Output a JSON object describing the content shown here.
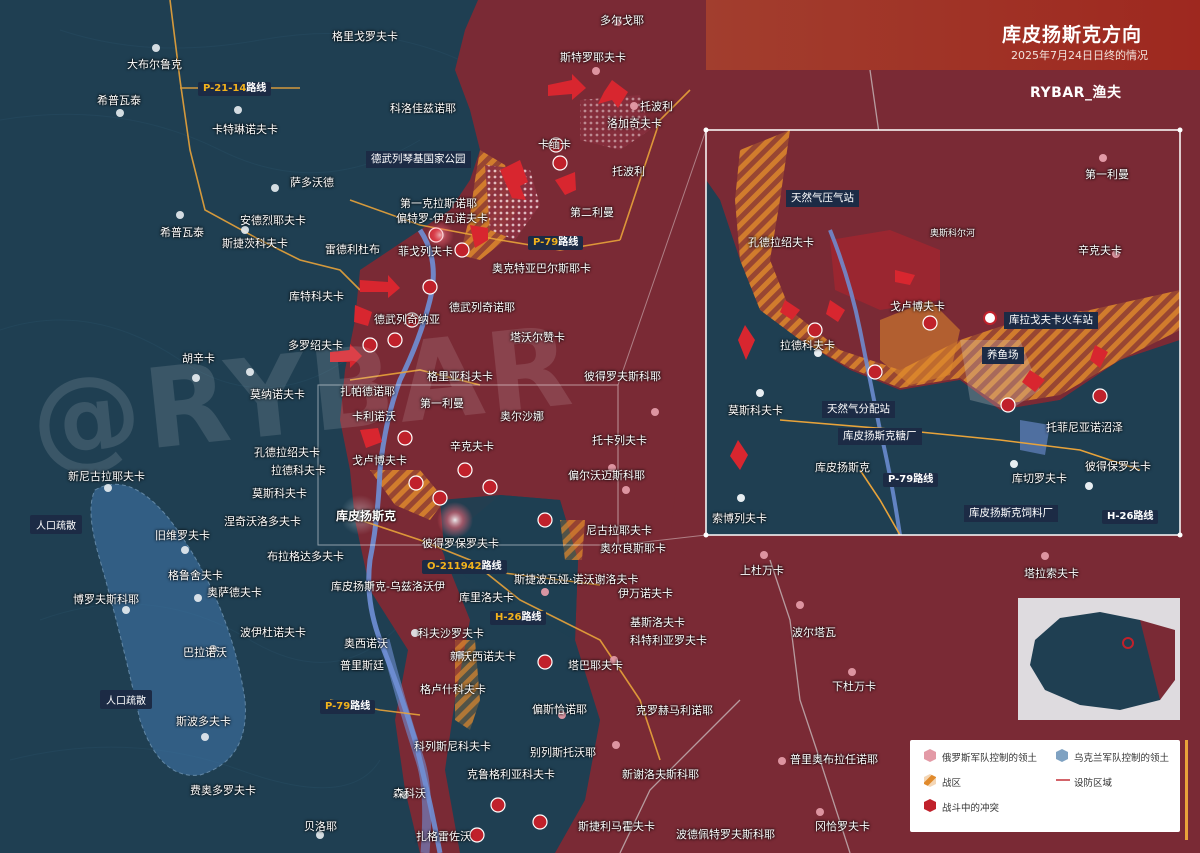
{
  "header": {
    "title": "库皮扬斯克方向",
    "subtitle": "2025年7月24日日终的情况",
    "brand": "RYBAR_渔夫"
  },
  "watermark": "@RYBAR",
  "colors": {
    "russian_territory": "#7a2a35",
    "ukrainian_territory": "#1f3f52",
    "combat_zone": "#e08a2c",
    "road": "#e8a33a",
    "river": "#6f8fd6",
    "accent_red": "#c0212b"
  },
  "roads": {
    "p2114": {
      "code": "P-21-14",
      "suffix": "路线"
    },
    "p79a": {
      "code": "P-79",
      "suffix": "路线"
    },
    "o211942": {
      "code": "O-211942",
      "suffix": "路线"
    },
    "h26": {
      "code": "H-26",
      "suffix": "路线"
    },
    "p79b": {
      "code": "P-79",
      "suffix": "路线"
    }
  },
  "evacuation": [
    "人口疏散",
    "人口疏散"
  ],
  "places": [
    "多尔戈耶",
    "格里戈罗夫卡",
    "大布尔鲁克",
    "斯特罗耶夫卡",
    "希普瓦泰",
    "科洛佳兹诺耶",
    "托波利",
    "洛加奇夫卡",
    "卡特琳诺夫卡",
    "卡缅卡",
    "德武列琴基国家公园",
    "萨多沃德",
    "托波利",
    "第一克拉斯诺耶",
    "安德烈耶夫卡",
    "偏特罗-伊瓦诺夫卡",
    "第二利曼",
    "希普瓦泰",
    "斯捷茨科夫卡",
    "雷德利杜布",
    "菲戈列夫卡",
    "奥克特亚巴尔斯耶卡",
    "库特科夫卡",
    "德武列奇纳亚",
    "德武列奇诺耶",
    "塔沃尔赞卡",
    "胡辛卡",
    "多罗绍夫卡",
    "扎帕德诺耶",
    "格里亚科夫卡",
    "彼得罗夫斯科耶",
    "莫纳诺夫卡",
    "第一利曼",
    "卡利诺沃",
    "奥尔沙娜",
    "托卡列夫卡",
    "孔德拉绍夫卡",
    "辛克夫卡",
    "拉德科夫卡",
    "戈卢博夫卡",
    "偏尔沃迈斯科耶",
    "新尼古拉耶夫卡",
    "莫斯科夫卡",
    "库皮扬斯克",
    "人口疏散",
    "旧维罗夫卡",
    "涅奇沃洛多夫卡",
    "彼得罗保罗夫卡",
    "尼古拉耶夫卡",
    "布拉格达多夫卡",
    "奥尔良斯耶卡",
    "格鲁舍夫卡",
    "斯捷波瓦娅·诺沃谢洛夫卡",
    "O-211942路线",
    "博罗夫斯科耶",
    "奥萨德夫卡",
    "库皮扬斯克-乌兹洛沃伊",
    "库里洛夫卡",
    "伊万诺夫卡",
    "波伊杜诺夫卡",
    "科夫沙罗夫卡",
    "基斯洛夫卡",
    "科特利亚罗夫卡",
    "巴拉诺沃",
    "奥西诺沃",
    "新沃西诺夫卡",
    "塔巴耶夫卡",
    "普里斯廷",
    "格卢什科夫卡",
    "斯波多夫卡",
    "偏斯恰诺耶",
    "克罗赫马利诺耶",
    "科列斯尼科夫卡",
    "别列斯托沃耶",
    "克鲁格利亚科夫卡",
    "新谢洛夫斯科耶",
    "费奥多罗夫卡",
    "森科沃",
    "斯捷利马霍夫卡",
    "贝洛耶",
    "扎格雷佐沃",
    "波德佩特罗夫斯科耶",
    "上杜万卡",
    "塔拉索夫卡",
    "波尔塔瓦",
    "下杜万卡",
    "普里奥布拉任诺耶",
    "冈恰罗夫卡"
  ],
  "inset": {
    "places": [
      "天然气压气站",
      "孔德拉绍夫卡",
      "奥斯科尔河",
      "第一利曼",
      "辛克夫卡",
      "戈卢博夫卡",
      "库拉戈夫卡火车站",
      "拉德科夫卡",
      "养鱼场",
      "莫斯科夫卡",
      "天然气分配站",
      "托菲尼亚诺沼泽",
      "库皮扬斯克糖厂",
      "库皮扬斯克",
      "库切罗夫卡",
      "彼得保罗夫卡",
      "P-79路线",
      "索博列夫卡",
      "库皮扬斯克饲料厂",
      "H-26路线"
    ]
  },
  "legend": {
    "items": [
      {
        "label": "俄罗斯军队控制的领土"
      },
      {
        "label": "乌克兰军队控制的领土"
      },
      {
        "label": "战区"
      },
      {
        "label": "设防区域"
      },
      {
        "label": "战斗中的冲突"
      }
    ]
  }
}
